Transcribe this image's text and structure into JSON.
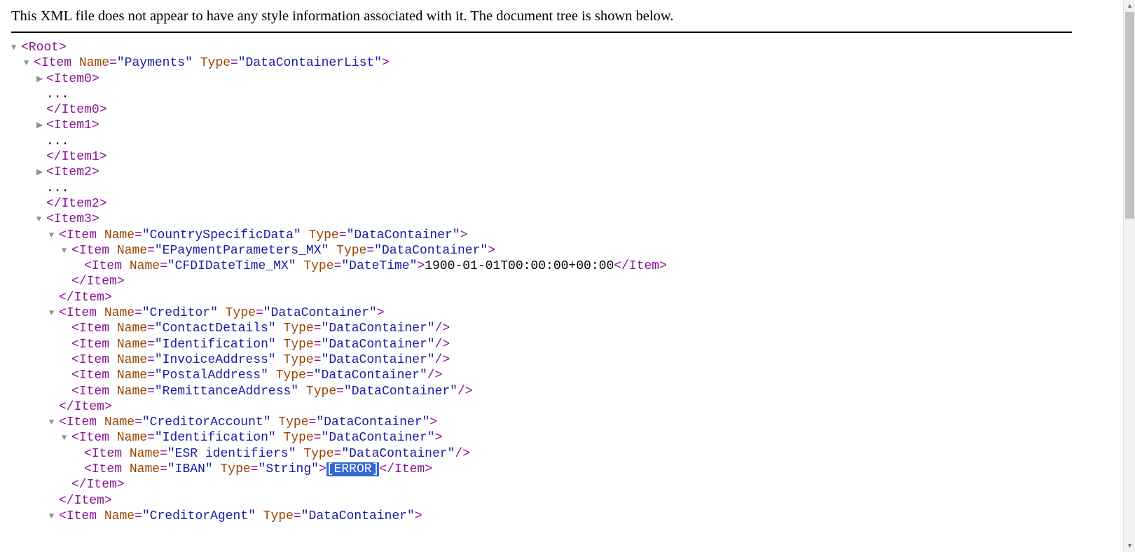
{
  "banner": "This XML file does not appear to have any style information associated with it. The document tree is shown below.",
  "glyphs": {
    "open": "▼",
    "closed": "▶"
  },
  "lines": [
    {
      "id": "l0",
      "indent": 1,
      "arrow": "open",
      "parts": [
        {
          "c": "pun",
          "t": "<"
        },
        {
          "c": "tag",
          "t": "Root"
        },
        {
          "c": "pun",
          "t": ">"
        }
      ]
    },
    {
      "id": "l1",
      "indent": 2,
      "arrow": "open",
      "parts": [
        {
          "c": "pun",
          "t": "<"
        },
        {
          "c": "tag",
          "t": "Item"
        },
        {
          "c": "text",
          "t": " "
        },
        {
          "c": "attrn",
          "t": "Name"
        },
        {
          "c": "pun",
          "t": "="
        },
        {
          "c": "attrv",
          "t": "\"Payments\""
        },
        {
          "c": "text",
          "t": " "
        },
        {
          "c": "attrn",
          "t": "Type"
        },
        {
          "c": "pun",
          "t": "="
        },
        {
          "c": "attrv",
          "t": "\"DataContainerList\""
        },
        {
          "c": "pun",
          "t": ">"
        }
      ]
    },
    {
      "id": "l2",
      "indent": 3,
      "arrow": "closed",
      "parts": [
        {
          "c": "pun",
          "t": "<"
        },
        {
          "c": "tag",
          "t": "Item0"
        },
        {
          "c": "pun",
          "t": ">"
        }
      ]
    },
    {
      "id": "l3",
      "indent": 3,
      "arrow": "none",
      "parts": [
        {
          "c": "dots",
          "t": "..."
        }
      ]
    },
    {
      "id": "l4",
      "indent": 3,
      "arrow": "none",
      "parts": [
        {
          "c": "pun",
          "t": "</"
        },
        {
          "c": "tag",
          "t": "Item0"
        },
        {
          "c": "pun",
          "t": ">"
        }
      ]
    },
    {
      "id": "l5",
      "indent": 3,
      "arrow": "closed",
      "parts": [
        {
          "c": "pun",
          "t": "<"
        },
        {
          "c": "tag",
          "t": "Item1"
        },
        {
          "c": "pun",
          "t": ">"
        }
      ]
    },
    {
      "id": "l6",
      "indent": 3,
      "arrow": "none",
      "parts": [
        {
          "c": "dots",
          "t": "..."
        }
      ]
    },
    {
      "id": "l7",
      "indent": 3,
      "arrow": "none",
      "parts": [
        {
          "c": "pun",
          "t": "</"
        },
        {
          "c": "tag",
          "t": "Item1"
        },
        {
          "c": "pun",
          "t": ">"
        }
      ]
    },
    {
      "id": "l8",
      "indent": 3,
      "arrow": "closed",
      "parts": [
        {
          "c": "pun",
          "t": "<"
        },
        {
          "c": "tag",
          "t": "Item2"
        },
        {
          "c": "pun",
          "t": ">"
        }
      ]
    },
    {
      "id": "l9",
      "indent": 3,
      "arrow": "none",
      "parts": [
        {
          "c": "dots",
          "t": "..."
        }
      ]
    },
    {
      "id": "l10",
      "indent": 3,
      "arrow": "none",
      "parts": [
        {
          "c": "pun",
          "t": "</"
        },
        {
          "c": "tag",
          "t": "Item2"
        },
        {
          "c": "pun",
          "t": ">"
        }
      ]
    },
    {
      "id": "l11",
      "indent": 3,
      "arrow": "open",
      "parts": [
        {
          "c": "pun",
          "t": "<"
        },
        {
          "c": "tag",
          "t": "Item3"
        },
        {
          "c": "pun",
          "t": ">"
        }
      ]
    },
    {
      "id": "l12",
      "indent": 4,
      "arrow": "open",
      "parts": [
        {
          "c": "pun",
          "t": "<"
        },
        {
          "c": "tag",
          "t": "Item"
        },
        {
          "c": "text",
          "t": " "
        },
        {
          "c": "attrn",
          "t": "Name"
        },
        {
          "c": "pun",
          "t": "="
        },
        {
          "c": "attrv",
          "t": "\"CountrySpecificData\""
        },
        {
          "c": "text",
          "t": " "
        },
        {
          "c": "attrn",
          "t": "Type"
        },
        {
          "c": "pun",
          "t": "="
        },
        {
          "c": "attrv",
          "t": "\"DataContainer\""
        },
        {
          "c": "pun",
          "t": ">"
        }
      ]
    },
    {
      "id": "l13",
      "indent": 5,
      "arrow": "open",
      "parts": [
        {
          "c": "pun",
          "t": "<"
        },
        {
          "c": "tag",
          "t": "Item"
        },
        {
          "c": "text",
          "t": " "
        },
        {
          "c": "attrn",
          "t": "Name"
        },
        {
          "c": "pun",
          "t": "="
        },
        {
          "c": "attrv",
          "t": "\"EPaymentParameters_MX\""
        },
        {
          "c": "text",
          "t": " "
        },
        {
          "c": "attrn",
          "t": "Type"
        },
        {
          "c": "pun",
          "t": "="
        },
        {
          "c": "attrv",
          "t": "\"DataContainer\""
        },
        {
          "c": "pun",
          "t": ">"
        }
      ]
    },
    {
      "id": "l14",
      "indent": 6,
      "arrow": "none",
      "parts": [
        {
          "c": "pun",
          "t": "<"
        },
        {
          "c": "tag",
          "t": "Item"
        },
        {
          "c": "text",
          "t": " "
        },
        {
          "c": "attrn",
          "t": "Name"
        },
        {
          "c": "pun",
          "t": "="
        },
        {
          "c": "attrv",
          "t": "\"CFDIDateTime_MX\""
        },
        {
          "c": "text",
          "t": " "
        },
        {
          "c": "attrn",
          "t": "Type"
        },
        {
          "c": "pun",
          "t": "="
        },
        {
          "c": "attrv",
          "t": "\"DateTime\""
        },
        {
          "c": "pun",
          "t": ">"
        },
        {
          "c": "text",
          "t": "1900-01-01T00:00:00+00:00"
        },
        {
          "c": "pun",
          "t": "</"
        },
        {
          "c": "tag",
          "t": "Item"
        },
        {
          "c": "pun",
          "t": ">"
        }
      ]
    },
    {
      "id": "l15",
      "indent": 5,
      "arrow": "none",
      "parts": [
        {
          "c": "pun",
          "t": "</"
        },
        {
          "c": "tag",
          "t": "Item"
        },
        {
          "c": "pun",
          "t": ">"
        }
      ]
    },
    {
      "id": "l16",
      "indent": 4,
      "arrow": "none",
      "parts": [
        {
          "c": "pun",
          "t": "</"
        },
        {
          "c": "tag",
          "t": "Item"
        },
        {
          "c": "pun",
          "t": ">"
        }
      ]
    },
    {
      "id": "l17",
      "indent": 4,
      "arrow": "open",
      "parts": [
        {
          "c": "pun",
          "t": "<"
        },
        {
          "c": "tag",
          "t": "Item"
        },
        {
          "c": "text",
          "t": " "
        },
        {
          "c": "attrn",
          "t": "Name"
        },
        {
          "c": "pun",
          "t": "="
        },
        {
          "c": "attrv",
          "t": "\"Creditor\""
        },
        {
          "c": "text",
          "t": " "
        },
        {
          "c": "attrn",
          "t": "Type"
        },
        {
          "c": "pun",
          "t": "="
        },
        {
          "c": "attrv",
          "t": "\"DataContainer\""
        },
        {
          "c": "pun",
          "t": ">"
        }
      ]
    },
    {
      "id": "l18",
      "indent": 5,
      "arrow": "none",
      "parts": [
        {
          "c": "pun",
          "t": "<"
        },
        {
          "c": "tag",
          "t": "Item"
        },
        {
          "c": "text",
          "t": " "
        },
        {
          "c": "attrn",
          "t": "Name"
        },
        {
          "c": "pun",
          "t": "="
        },
        {
          "c": "attrv",
          "t": "\"ContactDetails\""
        },
        {
          "c": "text",
          "t": " "
        },
        {
          "c": "attrn",
          "t": "Type"
        },
        {
          "c": "pun",
          "t": "="
        },
        {
          "c": "attrv",
          "t": "\"DataContainer\""
        },
        {
          "c": "pun",
          "t": "/>"
        }
      ]
    },
    {
      "id": "l19",
      "indent": 5,
      "arrow": "none",
      "parts": [
        {
          "c": "pun",
          "t": "<"
        },
        {
          "c": "tag",
          "t": "Item"
        },
        {
          "c": "text",
          "t": " "
        },
        {
          "c": "attrn",
          "t": "Name"
        },
        {
          "c": "pun",
          "t": "="
        },
        {
          "c": "attrv",
          "t": "\"Identification\""
        },
        {
          "c": "text",
          "t": " "
        },
        {
          "c": "attrn",
          "t": "Type"
        },
        {
          "c": "pun",
          "t": "="
        },
        {
          "c": "attrv",
          "t": "\"DataContainer\""
        },
        {
          "c": "pun",
          "t": "/>"
        }
      ]
    },
    {
      "id": "l20",
      "indent": 5,
      "arrow": "none",
      "parts": [
        {
          "c": "pun",
          "t": "<"
        },
        {
          "c": "tag",
          "t": "Item"
        },
        {
          "c": "text",
          "t": " "
        },
        {
          "c": "attrn",
          "t": "Name"
        },
        {
          "c": "pun",
          "t": "="
        },
        {
          "c": "attrv",
          "t": "\"InvoiceAddress\""
        },
        {
          "c": "text",
          "t": " "
        },
        {
          "c": "attrn",
          "t": "Type"
        },
        {
          "c": "pun",
          "t": "="
        },
        {
          "c": "attrv",
          "t": "\"DataContainer\""
        },
        {
          "c": "pun",
          "t": "/>"
        }
      ]
    },
    {
      "id": "l21",
      "indent": 5,
      "arrow": "none",
      "parts": [
        {
          "c": "pun",
          "t": "<"
        },
        {
          "c": "tag",
          "t": "Item"
        },
        {
          "c": "text",
          "t": " "
        },
        {
          "c": "attrn",
          "t": "Name"
        },
        {
          "c": "pun",
          "t": "="
        },
        {
          "c": "attrv",
          "t": "\"PostalAddress\""
        },
        {
          "c": "text",
          "t": " "
        },
        {
          "c": "attrn",
          "t": "Type"
        },
        {
          "c": "pun",
          "t": "="
        },
        {
          "c": "attrv",
          "t": "\"DataContainer\""
        },
        {
          "c": "pun",
          "t": "/>"
        }
      ]
    },
    {
      "id": "l22",
      "indent": 5,
      "arrow": "none",
      "parts": [
        {
          "c": "pun",
          "t": "<"
        },
        {
          "c": "tag",
          "t": "Item"
        },
        {
          "c": "text",
          "t": " "
        },
        {
          "c": "attrn",
          "t": "Name"
        },
        {
          "c": "pun",
          "t": "="
        },
        {
          "c": "attrv",
          "t": "\"RemittanceAddress\""
        },
        {
          "c": "text",
          "t": " "
        },
        {
          "c": "attrn",
          "t": "Type"
        },
        {
          "c": "pun",
          "t": "="
        },
        {
          "c": "attrv",
          "t": "\"DataContainer\""
        },
        {
          "c": "pun",
          "t": "/>"
        }
      ]
    },
    {
      "id": "l23",
      "indent": 4,
      "arrow": "none",
      "parts": [
        {
          "c": "pun",
          "t": "</"
        },
        {
          "c": "tag",
          "t": "Item"
        },
        {
          "c": "pun",
          "t": ">"
        }
      ]
    },
    {
      "id": "l24",
      "indent": 4,
      "arrow": "open",
      "parts": [
        {
          "c": "pun",
          "t": "<"
        },
        {
          "c": "tag",
          "t": "Item"
        },
        {
          "c": "text",
          "t": " "
        },
        {
          "c": "attrn",
          "t": "Name"
        },
        {
          "c": "pun",
          "t": "="
        },
        {
          "c": "attrv",
          "t": "\"CreditorAccount\""
        },
        {
          "c": "text",
          "t": " "
        },
        {
          "c": "attrn",
          "t": "Type"
        },
        {
          "c": "pun",
          "t": "="
        },
        {
          "c": "attrv",
          "t": "\"DataContainer\""
        },
        {
          "c": "pun",
          "t": ">"
        }
      ]
    },
    {
      "id": "l25",
      "indent": 5,
      "arrow": "open",
      "parts": [
        {
          "c": "pun",
          "t": "<"
        },
        {
          "c": "tag",
          "t": "Item"
        },
        {
          "c": "text",
          "t": " "
        },
        {
          "c": "attrn",
          "t": "Name"
        },
        {
          "c": "pun",
          "t": "="
        },
        {
          "c": "attrv",
          "t": "\"Identification\""
        },
        {
          "c": "text",
          "t": " "
        },
        {
          "c": "attrn",
          "t": "Type"
        },
        {
          "c": "pun",
          "t": "="
        },
        {
          "c": "attrv",
          "t": "\"DataContainer\""
        },
        {
          "c": "pun",
          "t": ">"
        }
      ]
    },
    {
      "id": "l26",
      "indent": 6,
      "arrow": "none",
      "parts": [
        {
          "c": "pun",
          "t": "<"
        },
        {
          "c": "tag",
          "t": "Item"
        },
        {
          "c": "text",
          "t": " "
        },
        {
          "c": "attrn",
          "t": "Name"
        },
        {
          "c": "pun",
          "t": "="
        },
        {
          "c": "attrv",
          "t": "\"ESR identifiers\""
        },
        {
          "c": "text",
          "t": " "
        },
        {
          "c": "attrn",
          "t": "Type"
        },
        {
          "c": "pun",
          "t": "="
        },
        {
          "c": "attrv",
          "t": "\"DataContainer\""
        },
        {
          "c": "pun",
          "t": "/>"
        }
      ]
    },
    {
      "id": "l27",
      "indent": 6,
      "arrow": "none",
      "parts": [
        {
          "c": "pun",
          "t": "<"
        },
        {
          "c": "tag",
          "t": "Item"
        },
        {
          "c": "text",
          "t": " "
        },
        {
          "c": "attrn",
          "t": "Name"
        },
        {
          "c": "pun",
          "t": "="
        },
        {
          "c": "attrv",
          "t": "\"IBAN\""
        },
        {
          "c": "text",
          "t": " "
        },
        {
          "c": "attrn",
          "t": "Type"
        },
        {
          "c": "pun",
          "t": "="
        },
        {
          "c": "attrv",
          "t": "\"String\""
        },
        {
          "c": "pun",
          "t": ">"
        },
        {
          "c": "sel",
          "t": "[ERROR]"
        },
        {
          "c": "pun",
          "t": "</"
        },
        {
          "c": "tag",
          "t": "Item"
        },
        {
          "c": "pun",
          "t": ">"
        }
      ]
    },
    {
      "id": "l28",
      "indent": 5,
      "arrow": "none",
      "parts": [
        {
          "c": "pun",
          "t": "</"
        },
        {
          "c": "tag",
          "t": "Item"
        },
        {
          "c": "pun",
          "t": ">"
        }
      ]
    },
    {
      "id": "l29",
      "indent": 4,
      "arrow": "none",
      "parts": [
        {
          "c": "pun",
          "t": "</"
        },
        {
          "c": "tag",
          "t": "Item"
        },
        {
          "c": "pun",
          "t": ">"
        }
      ]
    },
    {
      "id": "l30",
      "indent": 4,
      "arrow": "open",
      "parts": [
        {
          "c": "pun",
          "t": "<"
        },
        {
          "c": "tag",
          "t": "Item"
        },
        {
          "c": "text",
          "t": " "
        },
        {
          "c": "attrn",
          "t": "Name"
        },
        {
          "c": "pun",
          "t": "="
        },
        {
          "c": "attrv",
          "t": "\"CreditorAgent\""
        },
        {
          "c": "text",
          "t": " "
        },
        {
          "c": "attrn",
          "t": "Type"
        },
        {
          "c": "pun",
          "t": "="
        },
        {
          "c": "attrv",
          "t": "\"DataContainer\""
        },
        {
          "c": "pun",
          "t": ">"
        }
      ]
    }
  ]
}
